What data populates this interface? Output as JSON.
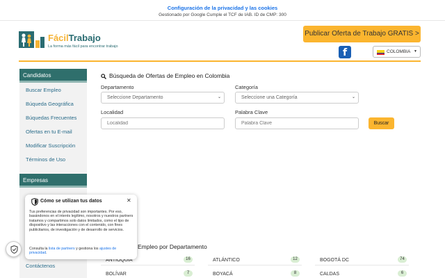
{
  "consent_banner": {
    "link_text": "Configuración de la privacidad y las cookies",
    "subtitle": "Gestionado por Google Cumple el TCF de IAB. ID de CMP: 300"
  },
  "brand": {
    "name_part1": "Fácil",
    "name_part2": "Trabajo",
    "tagline": "La forma más fácil para encontrar trabajo"
  },
  "header": {
    "publish_button": "Publicar Oferta de Trabajo GRATIS >",
    "facebook_icon": "facebook-icon",
    "country": "COLOMBIA",
    "accent_color": "#fbb52f",
    "brand_color": "#2f6f6c"
  },
  "sidebar": {
    "candidates_heading": "Candidatos",
    "candidates_items": [
      "Buscar Empleo",
      "Búqueda Geográfica",
      "Búquedas Frecuentes",
      "Ofertas en tu E-mail",
      "Modificar Suscripción",
      "Términos de Uso"
    ],
    "companies_heading": "Empresas",
    "contact_item": "Contáctenos"
  },
  "search": {
    "title": "Búsqueda de Ofertas de Empleo en Colombia",
    "departamento_label": "Departamento",
    "departamento_value": "Seleccione Departamento",
    "categoria_label": "Categoría",
    "categoria_value": "Seleccione una Categoría",
    "localidad_label": "Localidad",
    "localidad_placeholder": "Localidad",
    "palabra_label": "Palabra Clave",
    "palabra_placeholder": "Palabra Clave",
    "button": "Buscar"
  },
  "departments": {
    "title": "Empleo por Departamento",
    "items": [
      {
        "name": "ANTIOQUIA",
        "count": "16"
      },
      {
        "name": "ATLÁNTICO",
        "count": "12"
      },
      {
        "name": "BOGOTÁ DC",
        "count": "74"
      },
      {
        "name": "BOLÍVAR",
        "count": "7"
      },
      {
        "name": "BOYACÁ",
        "count": "8"
      },
      {
        "name": "CALDAS",
        "count": "6"
      }
    ]
  },
  "privacy_popup": {
    "title": "Cómo se utilizan tus datos",
    "body": "Tus preferencias de privacidad son importantes. Por eso, basándonos en el interés legítimo, nosotros y nuestros partners tratamos y compartimos solo datos limitados, como el tipo de dispositivo y las interacciones con el contenido, con fines publicitarios, de investigación y de desarrollo de servicios.",
    "footer_prefix": "Consulta la",
    "partners_link": "lista de partners",
    "footer_middle": "y gestiona los",
    "settings_link": "ajustes de privacidad",
    "footer_suffix": "."
  }
}
